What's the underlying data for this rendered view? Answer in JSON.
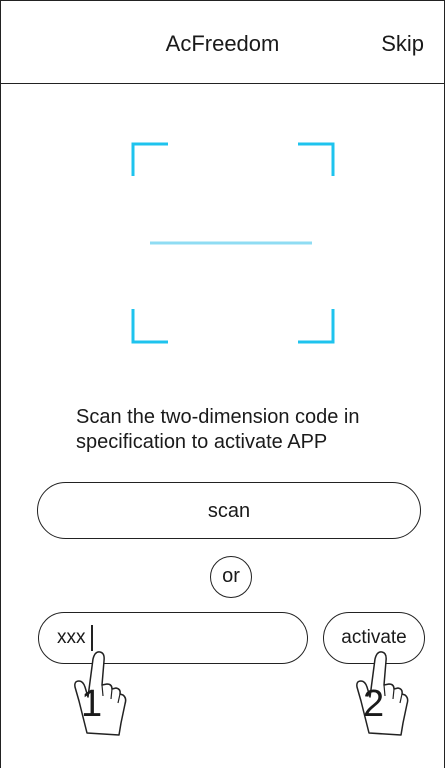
{
  "header": {
    "title": "AcFreedom",
    "skip_label": "Skip"
  },
  "scanner": {
    "frame_color": "#1ec3ee",
    "scan_line_color": "#8fdcf3"
  },
  "instruction": "Scan the two-dimension code in specification to activate APP",
  "scan_button": {
    "label": "scan"
  },
  "divider_text": "or",
  "activation_code_field": {
    "value": "xxx"
  },
  "activate_button": {
    "label": "activate"
  },
  "steps": [
    {
      "number": "1"
    },
    {
      "number": "2"
    }
  ]
}
